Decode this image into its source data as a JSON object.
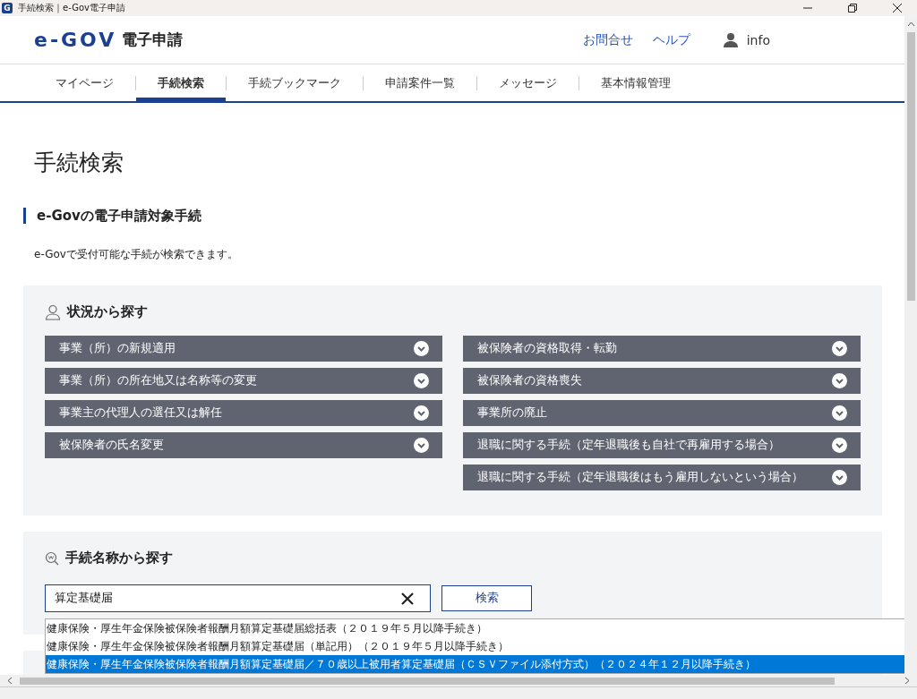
{
  "window": {
    "app_icon": "G",
    "title": "手続検索｜e-Gov電子申請"
  },
  "header": {
    "logo": "e-GOV",
    "service": "電子申請",
    "links": [
      "お問合せ",
      "ヘルプ"
    ],
    "user": "info"
  },
  "nav": [
    {
      "label": "マイページ",
      "selected": false
    },
    {
      "label": "手続検索",
      "selected": true
    },
    {
      "label": "手続ブックマーク",
      "selected": false
    },
    {
      "label": "申請案件一覧",
      "selected": false
    },
    {
      "label": "メッセージ",
      "selected": false
    },
    {
      "label": "基本情報管理",
      "selected": false
    }
  ],
  "page_title": "手続検索",
  "section_heading": "e-Govの電子申請対象手続",
  "description": "e-Govで受付可能な手続が検索できます。",
  "situation_panel": {
    "title": "状況から探す",
    "columns": [
      [
        {
          "label": "事業（所）の新規適用",
          "expanded": false
        },
        {
          "label": "事業（所）の所在地又は名称等の変更",
          "expanded": false
        },
        {
          "label": "事業主の代理人の選任又は解任",
          "expanded": false
        },
        {
          "label": "被保険者の氏名変更",
          "expanded": false
        }
      ],
      [
        {
          "label": "被保険者の資格取得・転勤",
          "expanded": false
        },
        {
          "label": "被保険者の資格喪失",
          "expanded": false
        },
        {
          "label": "事業所の廃止",
          "expanded": false
        },
        {
          "label": "退職に関する手続（定年退職後も自社で再雇用する場合）",
          "expanded": false
        },
        {
          "label": "退職に関する手続（定年退職後はもう雇用しないという場合）",
          "expanded": false
        }
      ]
    ]
  },
  "name_panel": {
    "title": "手続名称から探す",
    "search_value": "算定基礎届",
    "search_button": "検索",
    "suggestions": [
      {
        "label": "健康保険・厚生年金保険被保険者報酬月額算定基礎届総括表（２０１９年５月以降手続き）",
        "selected": false
      },
      {
        "label": "健康保険・厚生年金保険被保険者報酬月額算定基礎届（単記用）（２０１９年５月以降手続き）",
        "selected": false
      },
      {
        "label": "健康保険・厚生年金保険被保険者報酬月額算定基礎届／７０歳以上被用者算定基礎届（ＣＳＶファイル添付方式）（２０２４年１２月以降手続き）",
        "selected": true
      }
    ]
  }
}
